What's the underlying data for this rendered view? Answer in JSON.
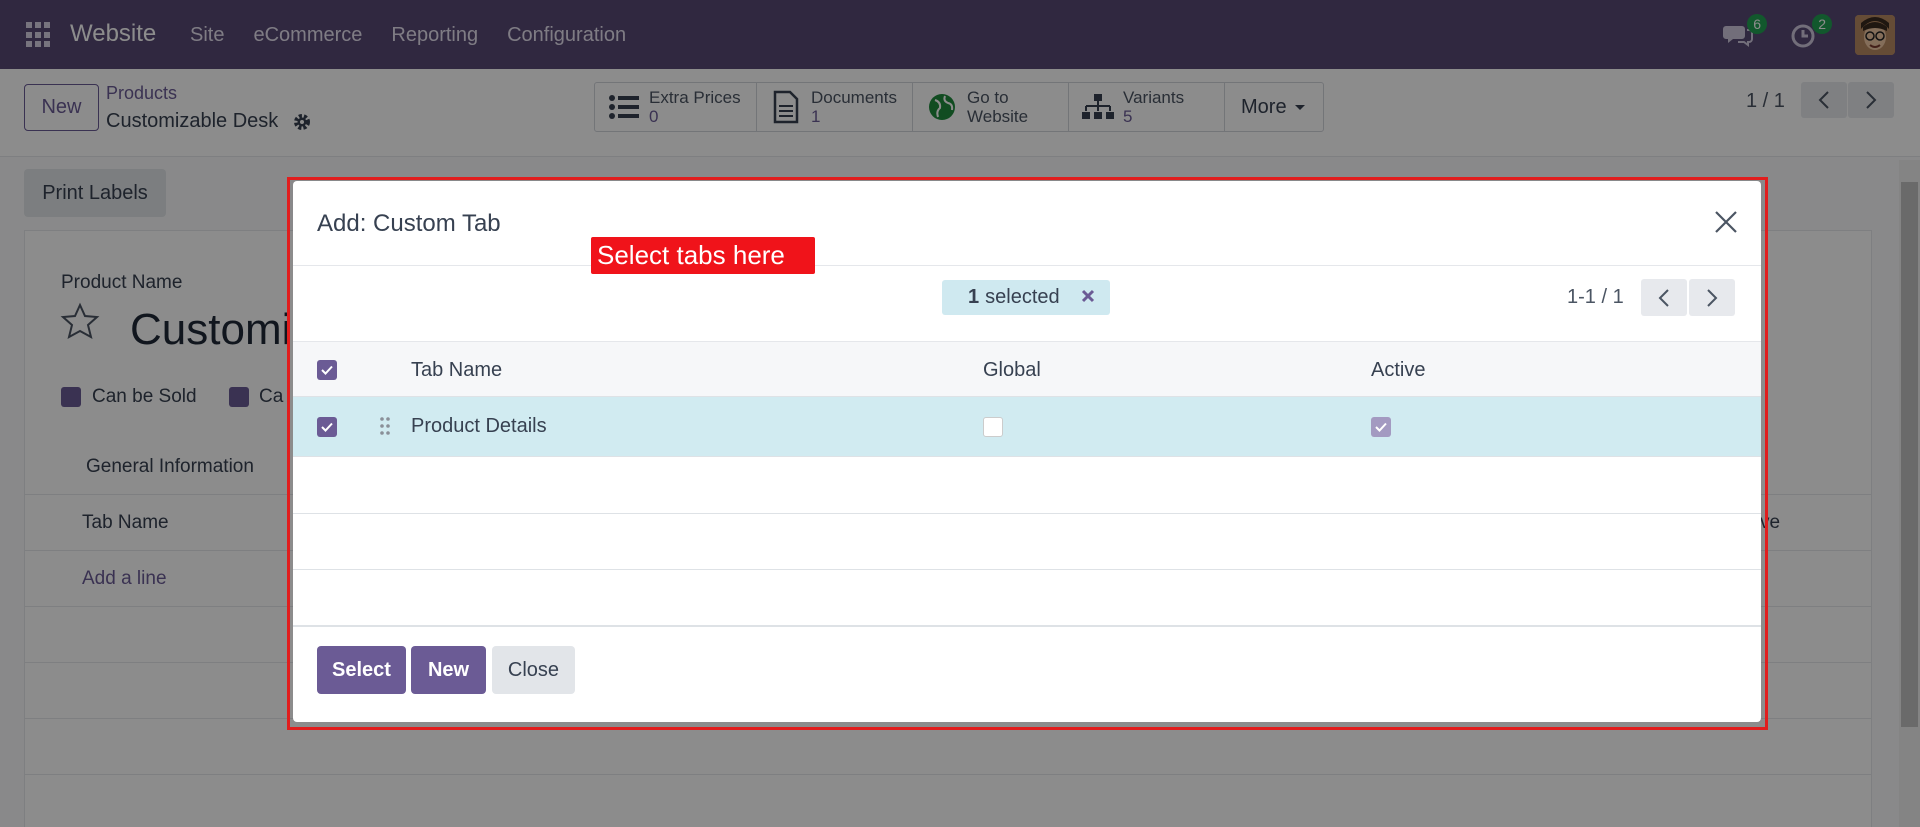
{
  "navbar": {
    "brand": "Website",
    "menu": [
      "Site",
      "eCommerce",
      "Reporting",
      "Configuration"
    ],
    "messages_count": "6",
    "activities_count": "2"
  },
  "control": {
    "new_label": "New",
    "breadcrumb_parent": "Products",
    "breadcrumb_current": "Customizable Desk",
    "smart_buttons": {
      "extra_prices": {
        "label": "Extra Prices",
        "value": "0"
      },
      "documents": {
        "label": "Documents",
        "value": "1"
      },
      "go_to_website": {
        "line1": "Go to",
        "line2": "Website"
      },
      "variants": {
        "label": "Variants",
        "value": "5"
      },
      "more": "More"
    },
    "pager": "1 / 1"
  },
  "form": {
    "print_labels": "Print Labels",
    "product_name_label": "Product Name",
    "product_name": "Customiz",
    "can_be_sold": "Can be Sold",
    "can_be_purchased_partial": "Ca",
    "tab_general": "General Information",
    "col_tab_name": "Tab Name",
    "col_active_partial": "ve",
    "add_line": "Add a line"
  },
  "modal": {
    "title": "Add: Custom Tab",
    "callout": "Select tabs here",
    "selected_count": "1",
    "selected_label": "selected",
    "pager": "1-1 / 1",
    "columns": {
      "tab_name": "Tab Name",
      "global": "Global",
      "active": "Active"
    },
    "rows": [
      {
        "tab_name": "Product Details",
        "selected": true,
        "global": false,
        "active": true
      }
    ],
    "buttons": {
      "select": "Select",
      "new": "New",
      "close": "Close"
    }
  },
  "colors": {
    "navbar": "#584a76",
    "primary": "#6b5b95",
    "selected_row": "#d1ebf1",
    "callout": "#f0131a",
    "highlight_border": "#e11d1d",
    "badge": "#22a052"
  }
}
